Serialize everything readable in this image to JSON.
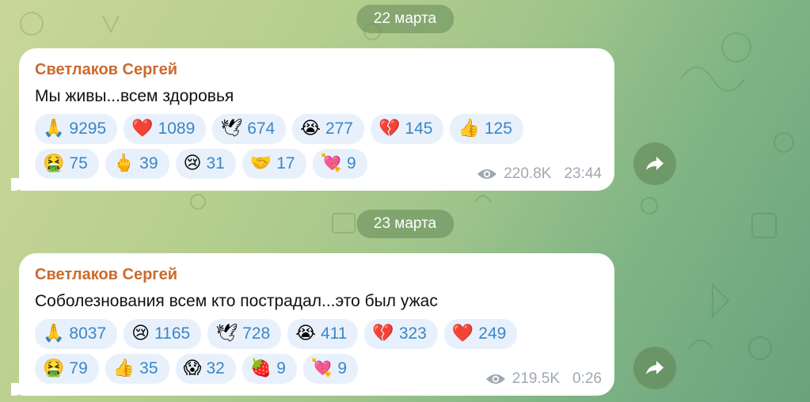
{
  "messages": [
    {
      "date": "22 марта",
      "sender": "Светлаков Сергей",
      "text": "Мы живы...всем здоровья",
      "reactions": [
        {
          "emoji": "🙏",
          "count": "9295"
        },
        {
          "emoji": "❤️",
          "count": "1089"
        },
        {
          "emoji": "🕊",
          "count": "674"
        },
        {
          "emoji": "😭",
          "count": "277"
        },
        {
          "emoji": "💔",
          "count": "145"
        },
        {
          "emoji": "👍",
          "count": "125"
        },
        {
          "emoji": "🤮",
          "count": "75"
        },
        {
          "emoji": "🖕",
          "count": "39"
        },
        {
          "emoji": "😢",
          "count": "31"
        },
        {
          "emoji": "🤝",
          "count": "17"
        },
        {
          "emoji": "💘",
          "count": "9"
        }
      ],
      "views": "220.8K",
      "time": "23:44"
    },
    {
      "date": "23 марта",
      "sender": "Светлаков Сергей",
      "text": "Соболезнования всем кто пострадал...это был ужас",
      "reactions": [
        {
          "emoji": "🙏",
          "count": "8037"
        },
        {
          "emoji": "😢",
          "count": "1165"
        },
        {
          "emoji": "🕊",
          "count": "728"
        },
        {
          "emoji": "😭",
          "count": "411"
        },
        {
          "emoji": "💔",
          "count": "323"
        },
        {
          "emoji": "❤️",
          "count": "249"
        },
        {
          "emoji": "🤮",
          "count": "79"
        },
        {
          "emoji": "👍",
          "count": "35"
        },
        {
          "emoji": "😱",
          "count": "32"
        },
        {
          "emoji": "🍓",
          "count": "9"
        },
        {
          "emoji": "💘",
          "count": "9"
        }
      ],
      "views": "219.5K",
      "time": "0:26"
    }
  ],
  "icons": {
    "views": "eye-icon",
    "share": "share-arrow-icon"
  },
  "colors": {
    "sender": "#cc6a2c",
    "reaction_count": "#3a86c8",
    "reaction_bg": "#e8f1fb",
    "meta": "#a0a8b0"
  }
}
